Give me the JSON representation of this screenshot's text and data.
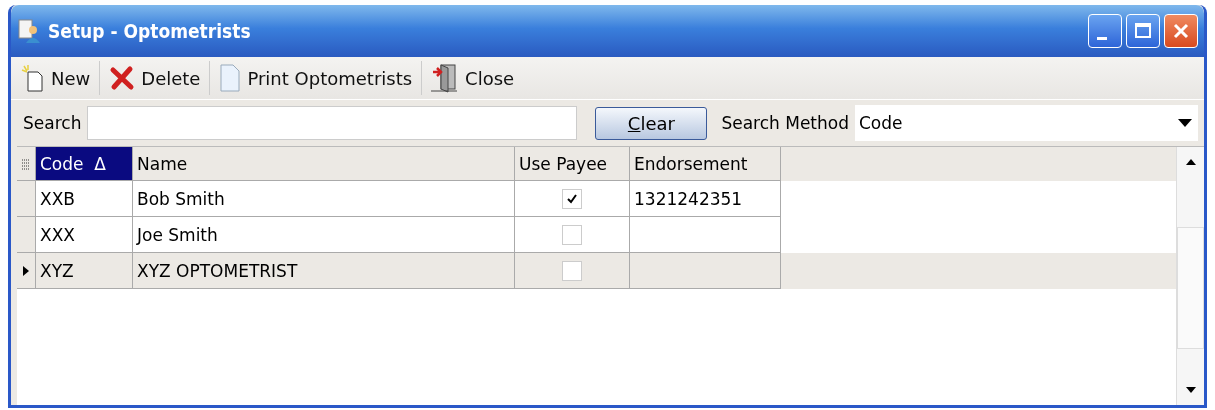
{
  "window": {
    "title": "Setup - Optometrists"
  },
  "toolbar": [
    {
      "kind": "new",
      "label": "New"
    },
    {
      "kind": "delete",
      "label": "Delete"
    },
    {
      "kind": "print",
      "label": "Print Optometrists"
    },
    {
      "kind": "close",
      "label": "Close"
    }
  ],
  "search": {
    "label": "Search",
    "clear_button": "Clear",
    "method_label": "Search Method",
    "method_value": "Code"
  },
  "table": {
    "columns": [
      {
        "label": "Code",
        "sort_mark": "Δ",
        "selected": true
      },
      {
        "label": "Name",
        "selected": false
      },
      {
        "label": "Use Payee",
        "selected": false
      },
      {
        "label": "Endorsement",
        "selected": false
      }
    ],
    "rows": [
      {
        "code": "XXB",
        "name": "Bob Smith",
        "use_payee": true,
        "endorsement": "1321242351",
        "selected": false
      },
      {
        "code": "XXX",
        "name": "Joe Smith",
        "use_payee": false,
        "selected": false
      },
      {
        "code": "XYZ",
        "name": "XYZ OPTOMETRIST",
        "use_payee": false,
        "selected": true
      }
    ]
  }
}
